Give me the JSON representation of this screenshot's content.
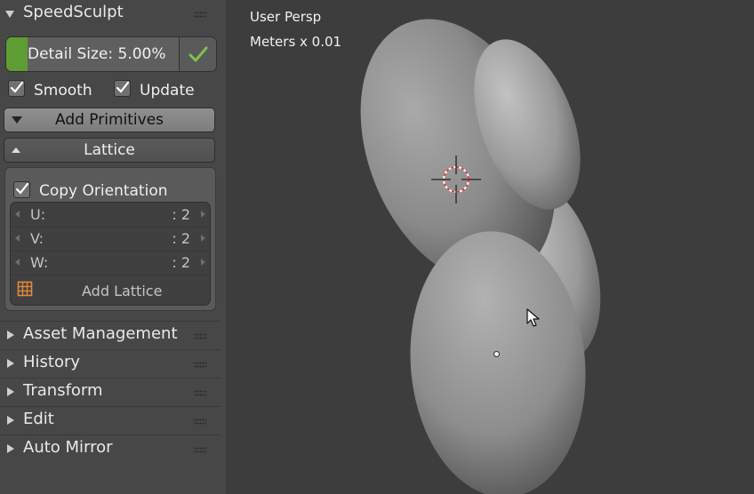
{
  "sidebar": {
    "title": "SpeedSculpt",
    "detail_size": {
      "label": "Detail Size: 5.00%",
      "fill_fraction": 0.1
    },
    "smooth_label": "Smooth",
    "update_label": "Update",
    "add_primitives_label": "Add Primitives",
    "lattice_label": "Lattice",
    "copy_orientation_label": "Copy Orientation",
    "fields": [
      {
        "name": "U:",
        "value": ": 2"
      },
      {
        "name": "V:",
        "value": ": 2"
      },
      {
        "name": "W:",
        "value": ": 2"
      }
    ],
    "add_lattice_label": "Add Lattice",
    "panels": [
      "Asset Management",
      "History",
      "Transform",
      "Edit",
      "Auto Mirror"
    ]
  },
  "viewport": {
    "view_label": "User Persp",
    "units_label": "Meters x 0.01"
  },
  "colors": {
    "accent_green": "#5f9c33",
    "lattice_icon": "#e08a3c",
    "cursor_red": "#d83b3b"
  }
}
